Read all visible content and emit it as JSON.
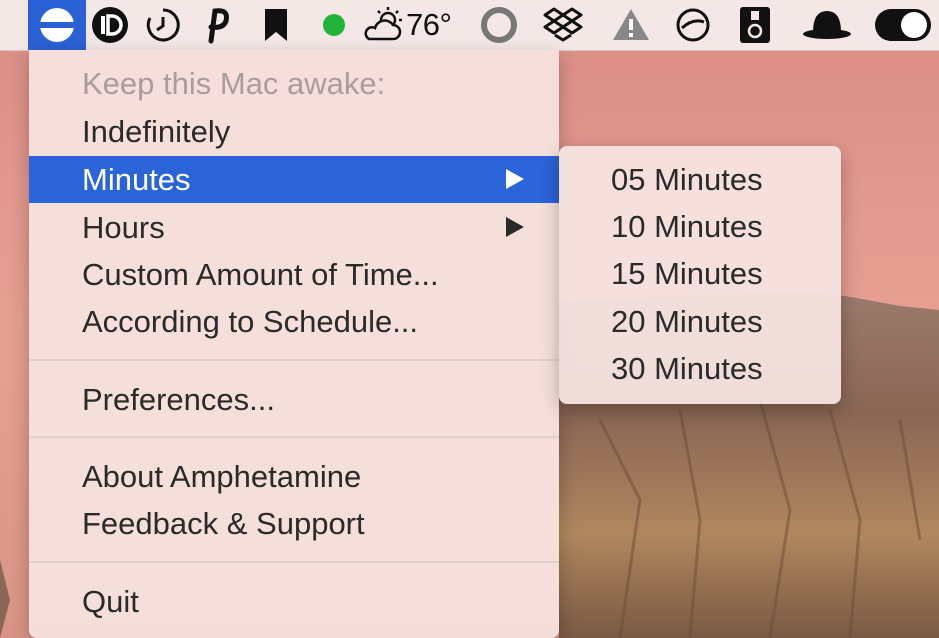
{
  "menubar": {
    "weather_temp": "76°",
    "icons": [
      "amphetamine-icon",
      "info-d-icon",
      "timer-icon",
      "pocket-p-icon",
      "bookmark-icon",
      "status-dot-icon",
      "weather-cloud-sun-icon",
      "ring-icon",
      "dropbox-icon",
      "drive-warning-icon",
      "no-entry-icon",
      "device-icon",
      "bowler-hat-icon",
      "toggle-switch-icon"
    ],
    "accent_color": "#2b63d8",
    "status_dot_color": "#22b33a"
  },
  "menu": {
    "header": "Keep this Mac awake:",
    "items": {
      "indefinitely": "Indefinitely",
      "minutes": "Minutes",
      "hours": "Hours",
      "custom": "Custom Amount of Time...",
      "schedule": "According to Schedule...",
      "preferences": "Preferences...",
      "about": "About Amphetamine",
      "feedback": "Feedback & Support",
      "quit": "Quit"
    }
  },
  "submenu": {
    "items": [
      "05 Minutes",
      "10 Minutes",
      "15 Minutes",
      "20 Minutes",
      "30 Minutes"
    ]
  }
}
